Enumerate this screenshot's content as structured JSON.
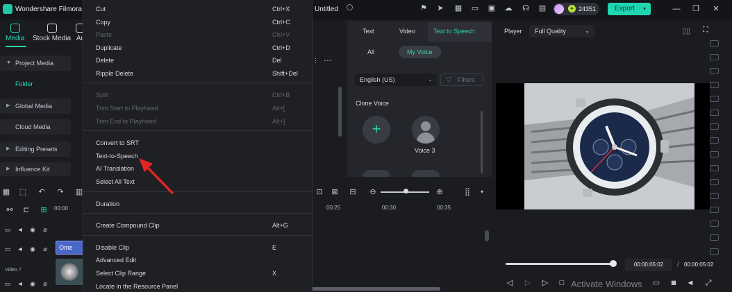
{
  "app": {
    "title": "Wondershare Filmora",
    "document_title": "Untitled"
  },
  "titlebar": {
    "credits": "24351",
    "export_label": "Export",
    "accent_color": "#20d6b0"
  },
  "left_panel": {
    "tabs": [
      {
        "label": "Media",
        "icon": "media-icon",
        "active": true
      },
      {
        "label": "Stock Media",
        "icon": "stock-media-icon"
      },
      {
        "label": "Au",
        "icon": "audio-icon"
      }
    ],
    "items": [
      {
        "label": "Project Media"
      },
      {
        "label": "Folder"
      },
      {
        "label": "Global Media"
      },
      {
        "label": "Cloud Media"
      },
      {
        "label": "Editing Presets"
      },
      {
        "label": "Influence Kit"
      }
    ]
  },
  "context_menu": {
    "items": [
      {
        "label": "Cut",
        "shortcut": "Ctrl+X",
        "enabled": true
      },
      {
        "label": "Copy",
        "shortcut": "Ctrl+C",
        "enabled": true
      },
      {
        "label": "Paste",
        "shortcut": "Ctrl+V",
        "enabled": false
      },
      {
        "label": "Duplicate",
        "shortcut": "Ctrl+D",
        "enabled": true
      },
      {
        "label": "Delete",
        "shortcut": "Del",
        "enabled": true
      },
      {
        "label": "Ripple Delete",
        "shortcut": "Shift+Del",
        "enabled": true
      },
      {
        "label": "Split",
        "shortcut": "Ctrl+B",
        "enabled": false
      },
      {
        "label": "Trim Start to Playhead",
        "shortcut": "Alt+[",
        "enabled": false
      },
      {
        "label": "Trim End to Playhead",
        "shortcut": "Alt+]",
        "enabled": false
      },
      {
        "label": "Convert to SRT",
        "shortcut": "",
        "enabled": true
      },
      {
        "label": "Text-to-Speech",
        "shortcut": "",
        "enabled": true
      },
      {
        "label": "AI Translation",
        "shortcut": "",
        "enabled": true
      },
      {
        "label": "Select All Text",
        "shortcut": "",
        "enabled": true
      },
      {
        "label": "Duration",
        "shortcut": "",
        "enabled": true
      },
      {
        "label": "Create Compound Clip",
        "shortcut": "Alt+G",
        "enabled": true
      },
      {
        "label": "Disable Clip",
        "shortcut": "E",
        "enabled": true
      },
      {
        "label": "Advanced Edit",
        "shortcut": "",
        "enabled": true
      },
      {
        "label": "Select Clip Range",
        "shortcut": "X",
        "enabled": true
      },
      {
        "label": "Locate in the Resource Panel",
        "shortcut": "",
        "enabled": true
      }
    ]
  },
  "text_panel": {
    "tabs": [
      "Text",
      "Video",
      "Text to Speech"
    ],
    "active_tab": "Text to Speech",
    "filters": [
      "All",
      "My Voice"
    ],
    "active_filter": "My Voice",
    "language": "English (US)",
    "filters_button": "Filters",
    "section_title": "Clone Voice",
    "voices": [
      {
        "name": "Voice 3"
      }
    ]
  },
  "timeline": {
    "ruler_start": "00:00",
    "ruler_labels": [
      "00:25",
      "00:30",
      "00:35"
    ],
    "title_clip": "Ome",
    "video_track_label": "Video 7"
  },
  "player": {
    "label": "Player",
    "quality": "Full Quality",
    "current_time": "00:00:05:02",
    "separator": "/",
    "total_time": "00:00:05:02",
    "progress": 1.0
  },
  "watermark": "Activate Windows"
}
